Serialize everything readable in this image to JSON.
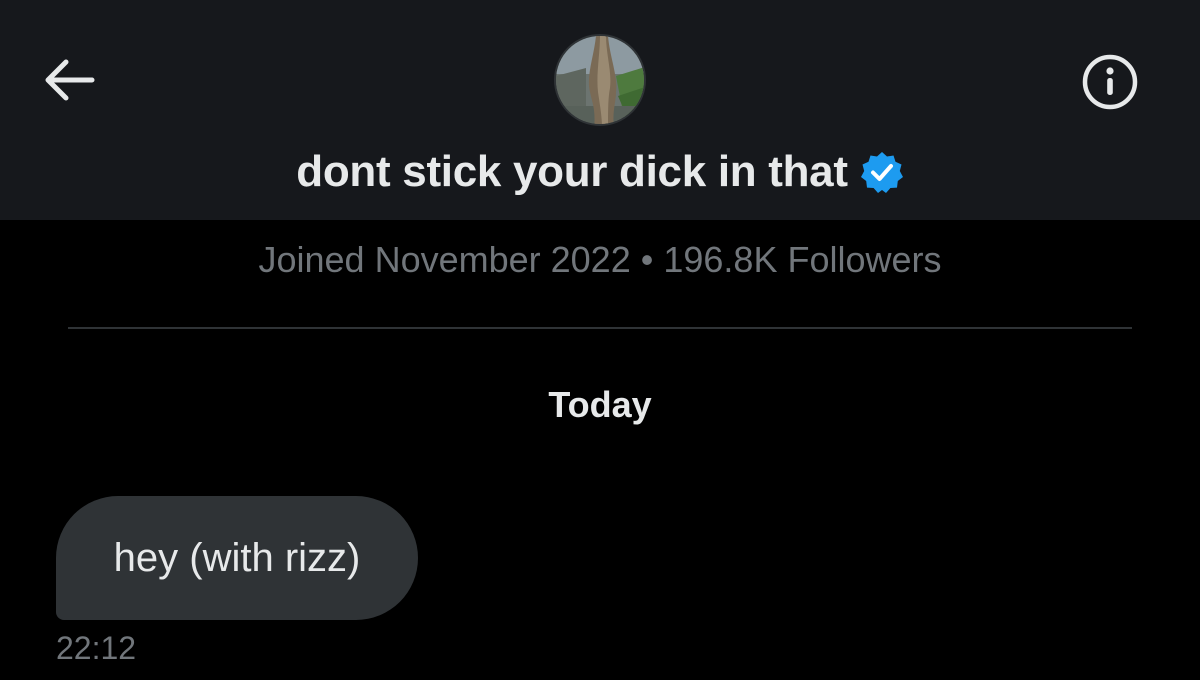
{
  "header": {
    "display_name": "dont stick your dick in that",
    "verified": true,
    "back_icon": "arrow-left-icon",
    "info_icon": "info-circle-icon",
    "avatar_icon": "avatar-tree-photo"
  },
  "profile": {
    "joined": "Joined November 2022",
    "separator": "•",
    "followers": "196.8K Followers"
  },
  "conversation": {
    "date_label": "Today",
    "messages": [
      {
        "text": "hey (with rizz)",
        "time": "22:12",
        "direction": "incoming"
      }
    ]
  },
  "colors": {
    "background": "#000000",
    "header_background": "#16181c",
    "bubble": "#2f3336",
    "primary_text": "#e7e9ea",
    "secondary_text": "#71767b",
    "verified_badge": "#1d9bf0",
    "top_pill_border": "#1f5a1f"
  }
}
